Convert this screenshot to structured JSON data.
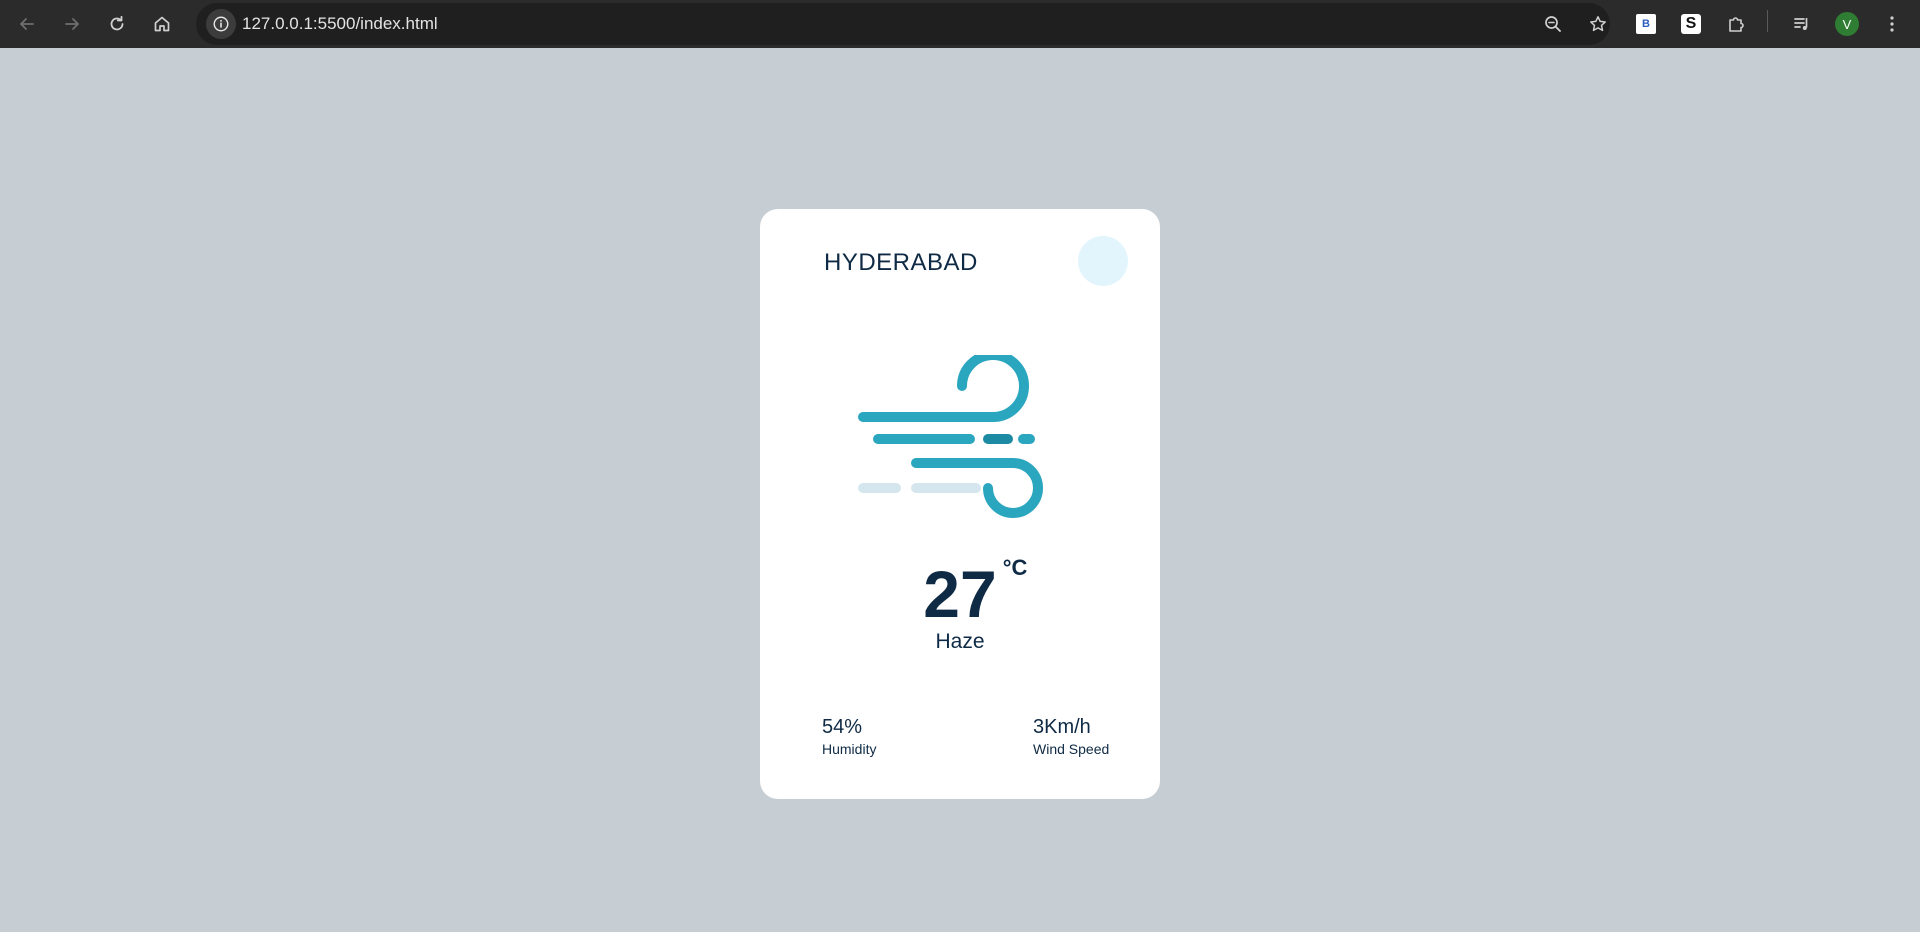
{
  "browser": {
    "url": "127.0.0.1:5500/index.html",
    "extensions": {
      "b_label": "B",
      "s_label": "S"
    },
    "profile_initial": "V"
  },
  "weather": {
    "city": "HYDERABAD",
    "temperature": "27",
    "unit": "°C",
    "condition": "Haze",
    "humidity_value": "54%",
    "humidity_label": "Humidity",
    "wind_value": "3Km/h",
    "wind_label": "Wind Speed",
    "icon": "wind-icon"
  },
  "colors": {
    "page_bg": "#c6ced4",
    "card_bg": "#ffffff",
    "text": "#0f2a44",
    "accent": "#2aa6bf",
    "accent_dark": "#1d8aa3",
    "accent_light": "#d5e6ee",
    "city_button": "#e2f5fd"
  }
}
